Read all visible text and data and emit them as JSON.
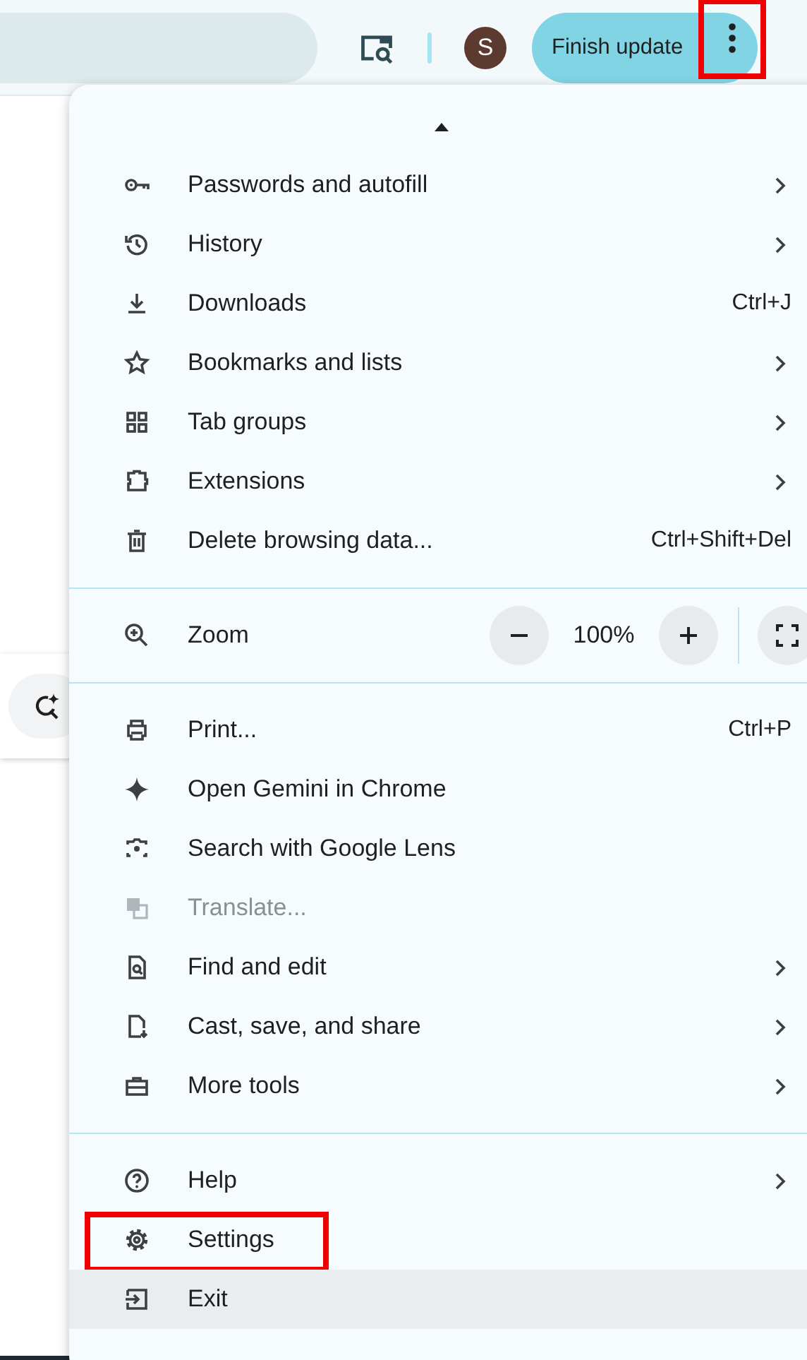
{
  "toolbar": {
    "avatar_letter": "S",
    "update_button": "Finish update",
    "menu_button_highlighted": true
  },
  "menu": {
    "sections": [
      {
        "kind": "items",
        "items": [
          {
            "label": "Passwords and autofill",
            "submenu": true,
            "disabled": false,
            "hovered": false,
            "highlighted": false
          },
          {
            "label": "History",
            "submenu": true,
            "disabled": false,
            "hovered": false,
            "highlighted": false
          },
          {
            "label": "Downloads",
            "shortcut": "Ctrl+J",
            "submenu": false,
            "disabled": false,
            "hovered": false,
            "highlighted": false
          },
          {
            "label": "Bookmarks and lists",
            "submenu": true,
            "disabled": false,
            "hovered": false,
            "highlighted": false
          },
          {
            "label": "Tab groups",
            "submenu": true,
            "disabled": false,
            "hovered": false,
            "highlighted": false
          },
          {
            "label": "Extensions",
            "submenu": true,
            "disabled": false,
            "hovered": false,
            "highlighted": false
          },
          {
            "label": "Delete browsing data...",
            "shortcut": "Ctrl+Shift+Del",
            "submenu": false,
            "disabled": false,
            "hovered": false,
            "highlighted": false
          }
        ]
      },
      {
        "kind": "zoom",
        "label": "Zoom",
        "value": "100%"
      },
      {
        "kind": "items",
        "items": [
          {
            "label": "Print...",
            "shortcut": "Ctrl+P",
            "submenu": false,
            "disabled": false,
            "hovered": false,
            "highlighted": false
          },
          {
            "label": "Open Gemini in Chrome",
            "submenu": false,
            "disabled": false,
            "hovered": false,
            "highlighted": false
          },
          {
            "label": "Search with Google Lens",
            "submenu": false,
            "disabled": false,
            "hovered": false,
            "highlighted": false
          },
          {
            "label": "Translate...",
            "submenu": false,
            "disabled": true,
            "hovered": false,
            "highlighted": false
          },
          {
            "label": "Find and edit",
            "submenu": true,
            "disabled": false,
            "hovered": false,
            "highlighted": false
          },
          {
            "label": "Cast, save, and share",
            "submenu": true,
            "disabled": false,
            "hovered": false,
            "highlighted": false
          },
          {
            "label": "More tools",
            "submenu": true,
            "disabled": false,
            "hovered": false,
            "highlighted": false
          }
        ]
      },
      {
        "kind": "items",
        "items": [
          {
            "label": "Help",
            "submenu": true,
            "disabled": false,
            "hovered": false,
            "highlighted": false
          },
          {
            "label": "Settings",
            "submenu": false,
            "disabled": false,
            "hovered": false,
            "highlighted": true
          },
          {
            "label": "Exit",
            "submenu": false,
            "disabled": false,
            "hovered": true,
            "highlighted": false
          }
        ]
      }
    ]
  }
}
